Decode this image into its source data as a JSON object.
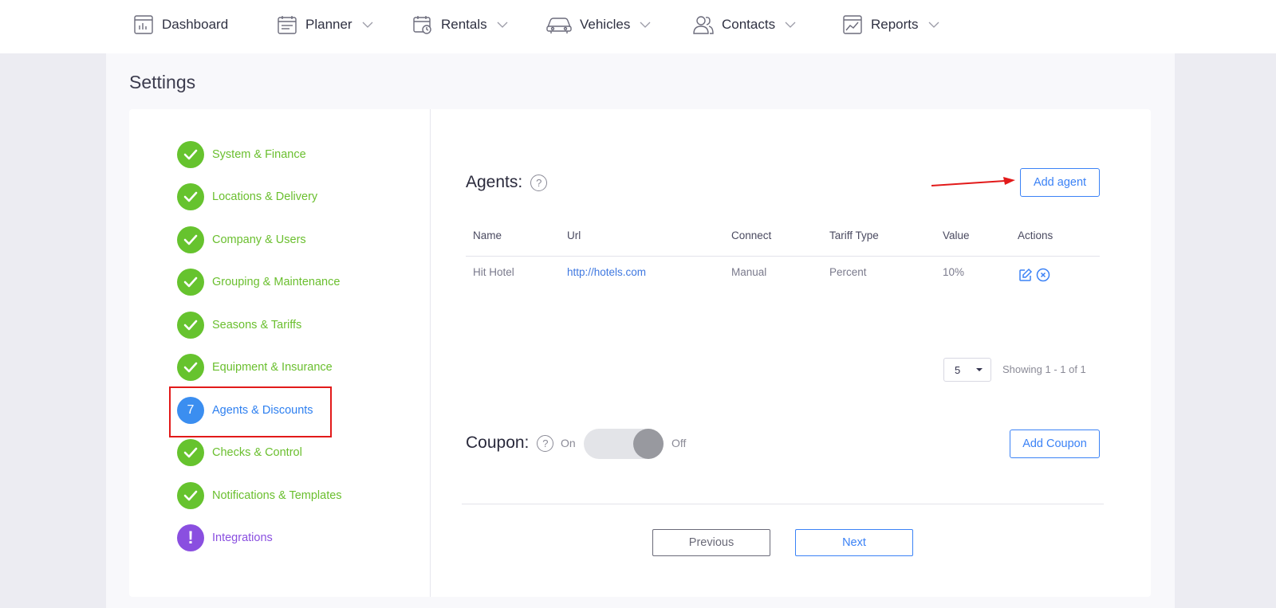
{
  "nav": {
    "dashboard": "Dashboard",
    "planner": "Planner",
    "rentals": "Rentals",
    "vehicles": "Vehicles",
    "contacts": "Contacts",
    "reports": "Reports"
  },
  "page": {
    "title": "Settings"
  },
  "steps": [
    {
      "label": "System & Finance",
      "state": "done"
    },
    {
      "label": "Locations & Delivery",
      "state": "done"
    },
    {
      "label": "Company & Users",
      "state": "done"
    },
    {
      "label": "Grouping & Maintenance",
      "state": "done"
    },
    {
      "label": "Seasons & Tariffs",
      "state": "done"
    },
    {
      "label": "Equipment & Insurance",
      "state": "done"
    },
    {
      "label": "Agents & Discounts",
      "state": "current",
      "number": "7"
    },
    {
      "label": "Checks & Control",
      "state": "done"
    },
    {
      "label": "Notifications & Templates",
      "state": "done"
    },
    {
      "label": "Integrations",
      "state": "warning",
      "symbol": "!"
    }
  ],
  "agents": {
    "title": "Agents:",
    "help": "?",
    "add_button": "Add agent",
    "columns": [
      "Name",
      "Url",
      "Connect",
      "Tariff Type",
      "Value",
      "Actions"
    ],
    "rows": [
      {
        "name": "Hit Hotel",
        "url": "http://hotels.com",
        "connect": "Manual",
        "tariff_type": "Percent",
        "value": "10%"
      }
    ],
    "page_size": "5",
    "showing": "Showing 1 - 1 of 1"
  },
  "coupon": {
    "title": "Coupon:",
    "help": "?",
    "on_label": "On",
    "off_label": "Off",
    "toggle_state": "off",
    "add_button": "Add Coupon"
  },
  "footer": {
    "previous": "Previous",
    "next": "Next"
  },
  "colors": {
    "done": "#66c32e",
    "current": "#3b8ef0",
    "warning": "#8a4fe0",
    "accent": "#3b82f6",
    "highlight": "#e21a1a"
  }
}
